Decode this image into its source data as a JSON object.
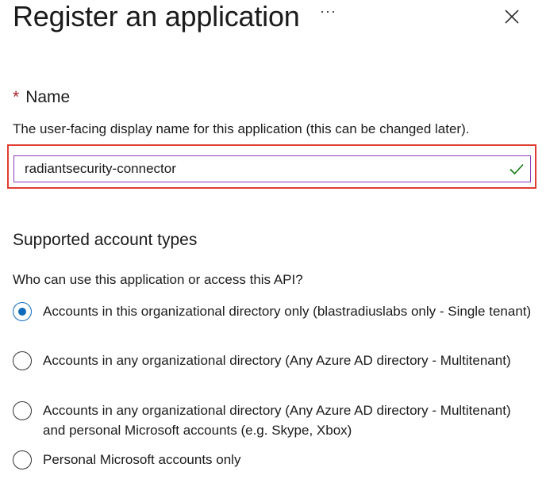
{
  "header": {
    "title": "Register an application",
    "more_label": "···"
  },
  "name_field": {
    "label": "Name",
    "required_marker": "*",
    "description": "The user-facing display name for this application (this can be changed later).",
    "value": "radiantsecurity-connector",
    "valid": true
  },
  "account_types": {
    "title": "Supported account types",
    "question": "Who can use this application or access this API?",
    "options": [
      {
        "label": "Accounts in this organizational directory only (blastradiuslabs only - Single tenant)",
        "selected": true
      },
      {
        "label": "Accounts in any organizational directory (Any Azure AD directory - Multitenant)",
        "selected": false
      },
      {
        "label": "Accounts in any organizational directory (Any Azure AD directory - Multitenant) and personal Microsoft accounts (e.g. Skype, Xbox)",
        "selected": false
      },
      {
        "label": "Personal Microsoft accounts only",
        "selected": false
      }
    ]
  },
  "colors": {
    "accent": "#0f6cbd",
    "required": "#a4262c",
    "highlight": "#e03c31",
    "input_border": "#8a3ab9",
    "success": "#107c10"
  },
  "icons": {
    "more": "more-icon",
    "close": "close-icon",
    "valid": "checkmark-icon"
  }
}
